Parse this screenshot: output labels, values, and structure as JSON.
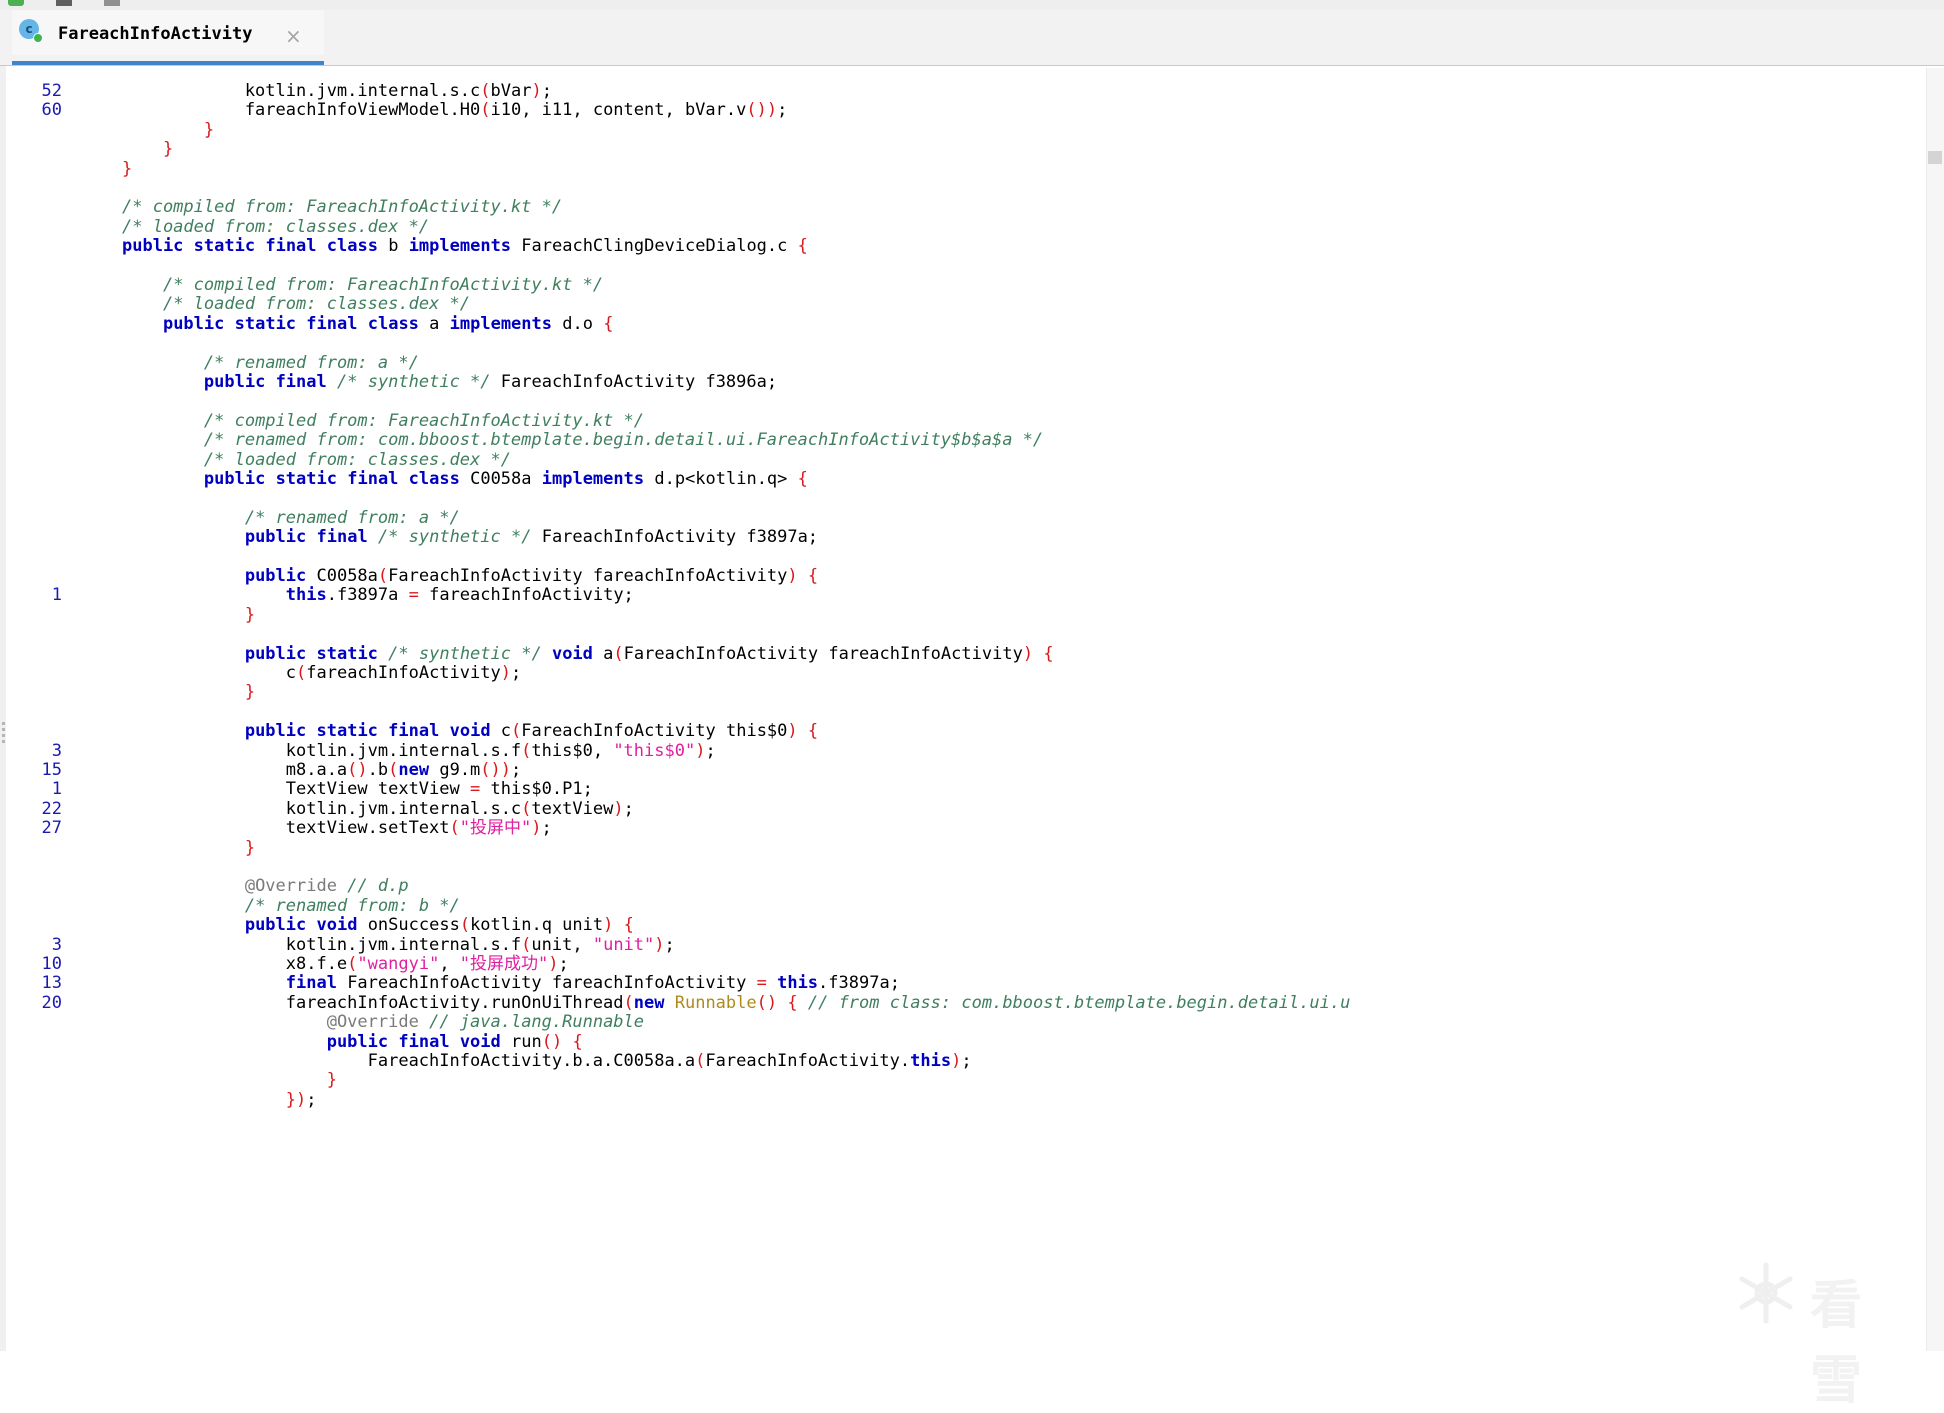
{
  "tab": {
    "title": "FareachInfoActivity",
    "icon_letter": "c",
    "icon": "class-icon",
    "close": "×"
  },
  "watermark": {
    "text": "看雪",
    "icon": "snowflake-icon"
  },
  "colors": {
    "keyword": "#0000c0",
    "comment": "#3f7f5f",
    "string": "#e020a0",
    "bracket": "#d9181c",
    "line_number": "#1a1ab3"
  },
  "lines": [
    {
      "n": "52",
      "code": "            kotlin.jvm.internal.s.c<b>(</b>bVar<b>)</b>;"
    },
    {
      "n": "60",
      "code": "            fareachInfoViewModel.H0<b>(</b>i10, i11, content, bVar.v<b>()</b><b>)</b>;"
    },
    {
      "n": "",
      "code": "        <b>}</b>"
    },
    {
      "n": "",
      "code": "    <b>}</b>"
    },
    {
      "n": "",
      "code": "<b>}</b>"
    },
    {
      "n": "",
      "code": ""
    },
    {
      "n": "",
      "code": "<c>/* compiled from: FareachInfoActivity.kt */</c>"
    },
    {
      "n": "",
      "code": "<c>/* loaded from: classes.dex */</c>"
    },
    {
      "n": "",
      "code": "<k>public</k> <k>static</k> <k>final</k> <k>class</k> b <k>implements</k> FareachClingDeviceDialog.c <b>{</b>"
    },
    {
      "n": "",
      "code": ""
    },
    {
      "n": "",
      "code": "    <c>/* compiled from: FareachInfoActivity.kt */</c>"
    },
    {
      "n": "",
      "code": "    <c>/* loaded from: classes.dex */</c>"
    },
    {
      "n": "",
      "code": "    <k>public</k> <k>static</k> <k>final</k> <k>class</k> a <k>implements</k> d.o <b>{</b>"
    },
    {
      "n": "",
      "code": ""
    },
    {
      "n": "",
      "code": "        <c>/* renamed from: a */</c>"
    },
    {
      "n": "",
      "code": "        <k>public</k> <k>final</k> <c>/* synthetic */</c> FareachInfoActivity f3896a;"
    },
    {
      "n": "",
      "code": ""
    },
    {
      "n": "",
      "code": "        <c>/* compiled from: FareachInfoActivity.kt */</c>"
    },
    {
      "n": "",
      "code": "        <c>/* renamed from: com.bboost.btemplate.begin.detail.ui.FareachInfoActivity$b$a$a */</c>"
    },
    {
      "n": "",
      "code": "        <c>/* loaded from: classes.dex */</c>"
    },
    {
      "n": "",
      "code": "        <k>public</k> <k>static</k> <k>final</k> <k>class</k> C0058a <k>implements</k> d.p&lt;kotlin.q&gt; <b>{</b>"
    },
    {
      "n": "",
      "code": ""
    },
    {
      "n": "",
      "code": "            <c>/* renamed from: a */</c>"
    },
    {
      "n": "",
      "code": "            <k>public</k> <k>final</k> <c>/* synthetic */</c> FareachInfoActivity f3897a;"
    },
    {
      "n": "",
      "code": ""
    },
    {
      "n": "",
      "code": "            <k>public</k> C0058a<b>(</b>FareachInfoActivity fareachInfoActivity<b>)</b> <b>{</b>"
    },
    {
      "n": "1",
      "code": "                <k>this</k>.f3897a <b>=</b> fareachInfoActivity;"
    },
    {
      "n": "",
      "code": "            <b>}</b>"
    },
    {
      "n": "",
      "code": ""
    },
    {
      "n": "",
      "code": "            <k>public</k> <k>static</k> <c>/* synthetic */</c> <k>void</k> a<b>(</b>FareachInfoActivity fareachInfoActivity<b>)</b> <b>{</b>"
    },
    {
      "n": "",
      "code": "                c<b>(</b>fareachInfoActivity<b>)</b>;"
    },
    {
      "n": "",
      "code": "            <b>}</b>"
    },
    {
      "n": "",
      "code": ""
    },
    {
      "n": "",
      "code": "            <k>public</k> <k>static</k> <k>final</k> <k>void</k> c<b>(</b>FareachInfoActivity this$0<b>)</b> <b>{</b>"
    },
    {
      "n": "3",
      "code": "                kotlin.jvm.internal.s.f<b>(</b>this$0, <s>\"this$0\"</s><b>)</b>;"
    },
    {
      "n": "15",
      "code": "                m8.a.a<b>()</b>.b<b>(</b><k>new</k> g9.m<b>()</b><b>)</b>;"
    },
    {
      "n": "1",
      "code": "                TextView textView <b>=</b> this$0.P1;"
    },
    {
      "n": "22",
      "code": "                kotlin.jvm.internal.s.c<b>(</b>textView<b>)</b>;"
    },
    {
      "n": "27",
      "code": "                textView.setText<b>(</b><s>\"投屏中\"</s><b>)</b>;"
    },
    {
      "n": "",
      "code": "            <b>}</b>"
    },
    {
      "n": "",
      "code": ""
    },
    {
      "n": "",
      "code": "            <a>@Override</a> <c>// d.p</c>"
    },
    {
      "n": "",
      "code": "            <c>/* renamed from: b */</c>"
    },
    {
      "n": "",
      "code": "            <k>public</k> <k>void</k> onSuccess<b>(</b>kotlin.q unit<b>)</b> <b>{</b>"
    },
    {
      "n": "3",
      "code": "                kotlin.jvm.internal.s.f<b>(</b>unit, <s>\"unit\"</s><b>)</b>;"
    },
    {
      "n": "10",
      "code": "                x8.f.e<b>(</b><s>\"wangyi\"</s>, <s>\"投屏成功\"</s><b>)</b>;"
    },
    {
      "n": "13",
      "code": "                <k>final</k> FareachInfoActivity fareachInfoActivity <b>=</b> <k>this</k>.f3897a;"
    },
    {
      "n": "20",
      "code": "                fareachInfoActivity.runOnUiThread<b>(</b><k>new</k> <i>Runnable</i><b>()</b> <b>{</b> <c>// from class: com.bboost.btemplate.begin.detail.ui.u</c>"
    },
    {
      "n": "",
      "code": "                    <a>@Override</a> <c>// java.lang.Runnable</c>"
    },
    {
      "n": "",
      "code": "                    <k>public</k> <k>final</k> <k>void</k> run<b>()</b> <b>{</b>"
    },
    {
      "n": "",
      "code": "                        FareachInfoActivity.b.a.C0058a.a<b>(</b>FareachInfoActivity.<k>this</k><b>)</b>;"
    },
    {
      "n": "",
      "code": "                    <b>}</b>"
    },
    {
      "n": "",
      "code": "                <b>}</b><b>)</b>;"
    }
  ]
}
